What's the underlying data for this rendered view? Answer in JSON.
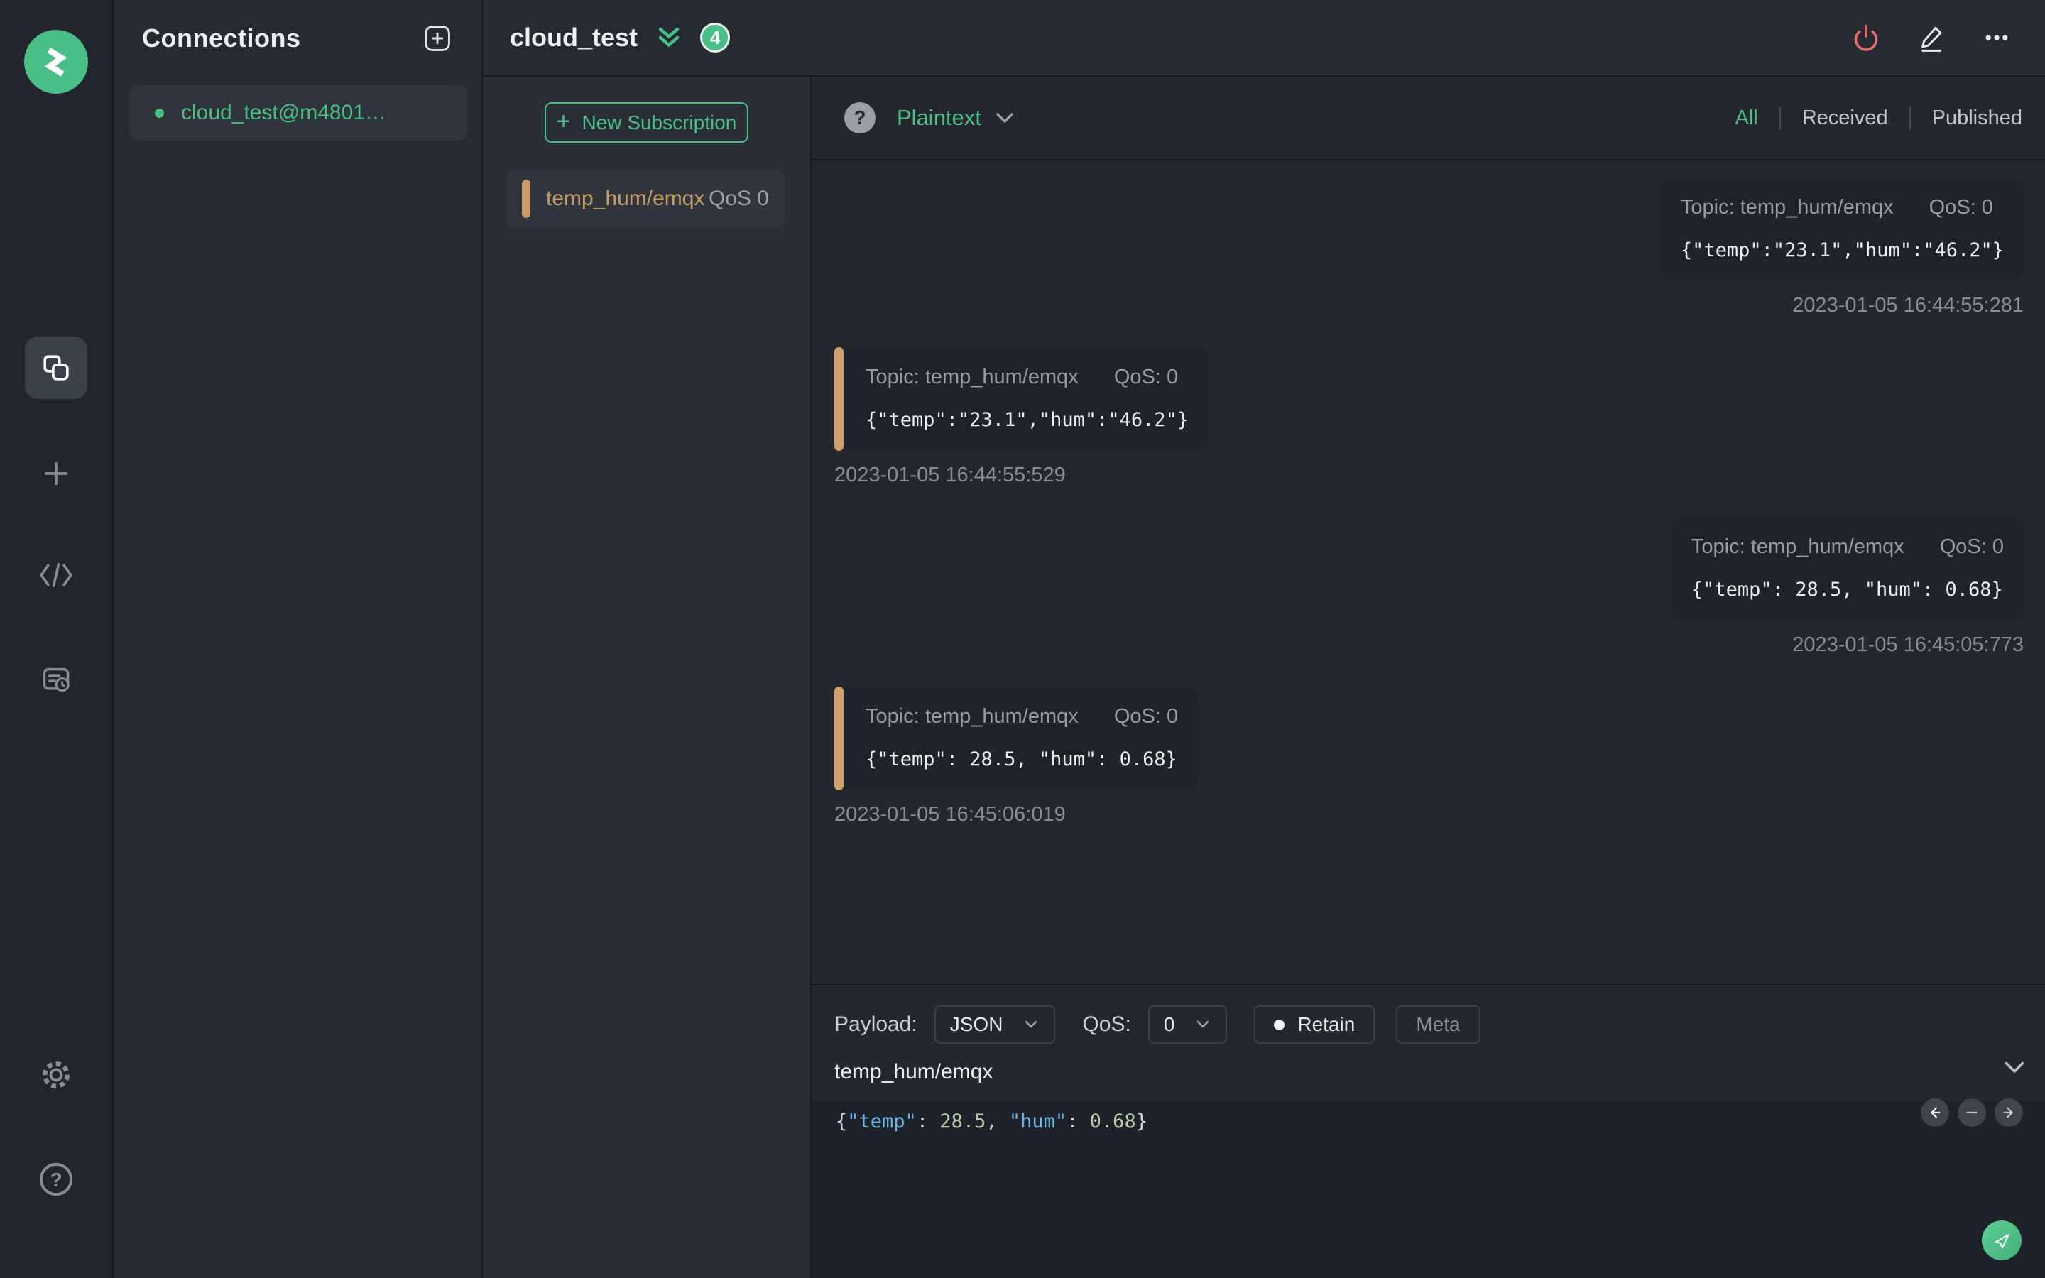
{
  "colors": {
    "accent_green": "#4abe87",
    "topic_orange": "#c79d63",
    "danger_red": "#e16b6b",
    "json_key_blue": "#6fb3e0",
    "json_number_green": "#b5cea8"
  },
  "connections_panel": {
    "title": "Connections",
    "connections": [
      {
        "name": "cloud_test@m4801…",
        "status": "connected"
      }
    ]
  },
  "header": {
    "connection_name": "cloud_test",
    "message_count_badge": "4"
  },
  "subscriptions": {
    "plus": "+",
    "new_subscription_label": "New Subscription",
    "items": [
      {
        "topic": "temp_hum/emqx",
        "qos": "QoS 0"
      }
    ]
  },
  "messages": {
    "help_glyph": "?",
    "format": "Plaintext",
    "filters": {
      "all": "All",
      "received": "Received",
      "published": "Published"
    },
    "active_filter": "All",
    "items": [
      {
        "direction": "published",
        "topic_label": "Topic: temp_hum/emqx",
        "qos_label": "QoS: 0",
        "payload": "{\"temp\":\"23.1\",\"hum\":\"46.2\"}",
        "timestamp": "2023-01-05 16:44:55:281"
      },
      {
        "direction": "received",
        "topic_label": "Topic: temp_hum/emqx",
        "qos_label": "QoS: 0",
        "payload": "{\"temp\":\"23.1\",\"hum\":\"46.2\"}",
        "timestamp": "2023-01-05 16:44:55:529"
      },
      {
        "direction": "published",
        "topic_label": "Topic: temp_hum/emqx",
        "qos_label": "QoS: 0",
        "payload": "{\"temp\": 28.5, \"hum\": 0.68}",
        "timestamp": "2023-01-05 16:45:05:773"
      },
      {
        "direction": "received",
        "topic_label": "Topic: temp_hum/emqx",
        "qos_label": "QoS: 0",
        "payload": "{\"temp\": 28.5, \"hum\": 0.68}",
        "timestamp": "2023-01-05 16:45:06:019"
      }
    ]
  },
  "publish": {
    "payload_label": "Payload:",
    "payload_format": "JSON",
    "qos_label": "QoS:",
    "qos_value": "0",
    "retain_label": "Retain",
    "meta_label": "Meta",
    "topic": "temp_hum/emqx",
    "editor_tokens": [
      {
        "text": "{",
        "type": "punct"
      },
      {
        "text": "\"temp\"",
        "type": "key"
      },
      {
        "text": ": ",
        "type": "punct"
      },
      {
        "text": "28.5",
        "type": "num"
      },
      {
        "text": ", ",
        "type": "punct"
      },
      {
        "text": "\"hum\"",
        "type": "key"
      },
      {
        "text": ": ",
        "type": "punct"
      },
      {
        "text": "0.68",
        "type": "num"
      },
      {
        "text": "}",
        "type": "punct"
      }
    ]
  }
}
